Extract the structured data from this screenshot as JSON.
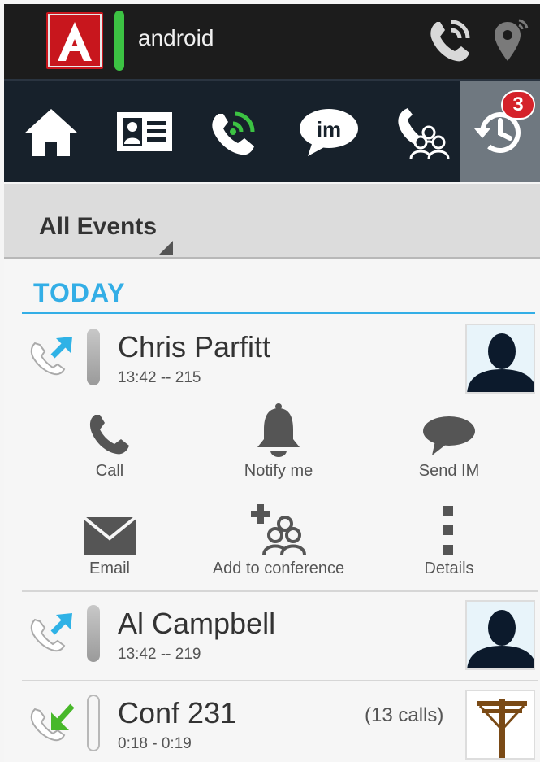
{
  "status_bar": {
    "app_logo_letter": "A",
    "username": "android",
    "presence_color": "#3cc243",
    "icons": [
      "call-status-icon",
      "location-icon"
    ]
  },
  "nav": {
    "items": [
      {
        "name": "home",
        "icon": "home-icon"
      },
      {
        "name": "contacts",
        "icon": "contact-card-icon"
      },
      {
        "name": "phone",
        "icon": "phone-icon"
      },
      {
        "name": "im",
        "icon": "im-icon",
        "label": "im"
      },
      {
        "name": "conference",
        "icon": "conference-icon"
      },
      {
        "name": "history",
        "icon": "history-icon",
        "active": true
      }
    ],
    "badge_count": "3",
    "badge_color": "#d5222a"
  },
  "filter": {
    "label": "All Events"
  },
  "section": {
    "title": "TODAY",
    "color": "#33aee6"
  },
  "entries": [
    {
      "name": "Chris Parfitt",
      "sub": "13:42  --  215",
      "direction": "outgoing",
      "actions": [
        {
          "label": "Call",
          "icon": "phone-handset-icon"
        },
        {
          "label": "Notify me",
          "icon": "bell-icon"
        },
        {
          "label": "Send IM",
          "icon": "speech-bubble-icon"
        },
        {
          "label": "Email",
          "icon": "envelope-icon"
        },
        {
          "label": "Add to conference",
          "icon": "add-conference-icon"
        },
        {
          "label": "Details",
          "icon": "more-vertical-icon"
        }
      ]
    },
    {
      "name": "Al Campbell",
      "sub": "13:42  --  219",
      "direction": "outgoing"
    },
    {
      "name": "Conf 231",
      "sub": "0:18 - 0:19",
      "extra": "(13 calls)",
      "direction": "incoming"
    }
  ]
}
